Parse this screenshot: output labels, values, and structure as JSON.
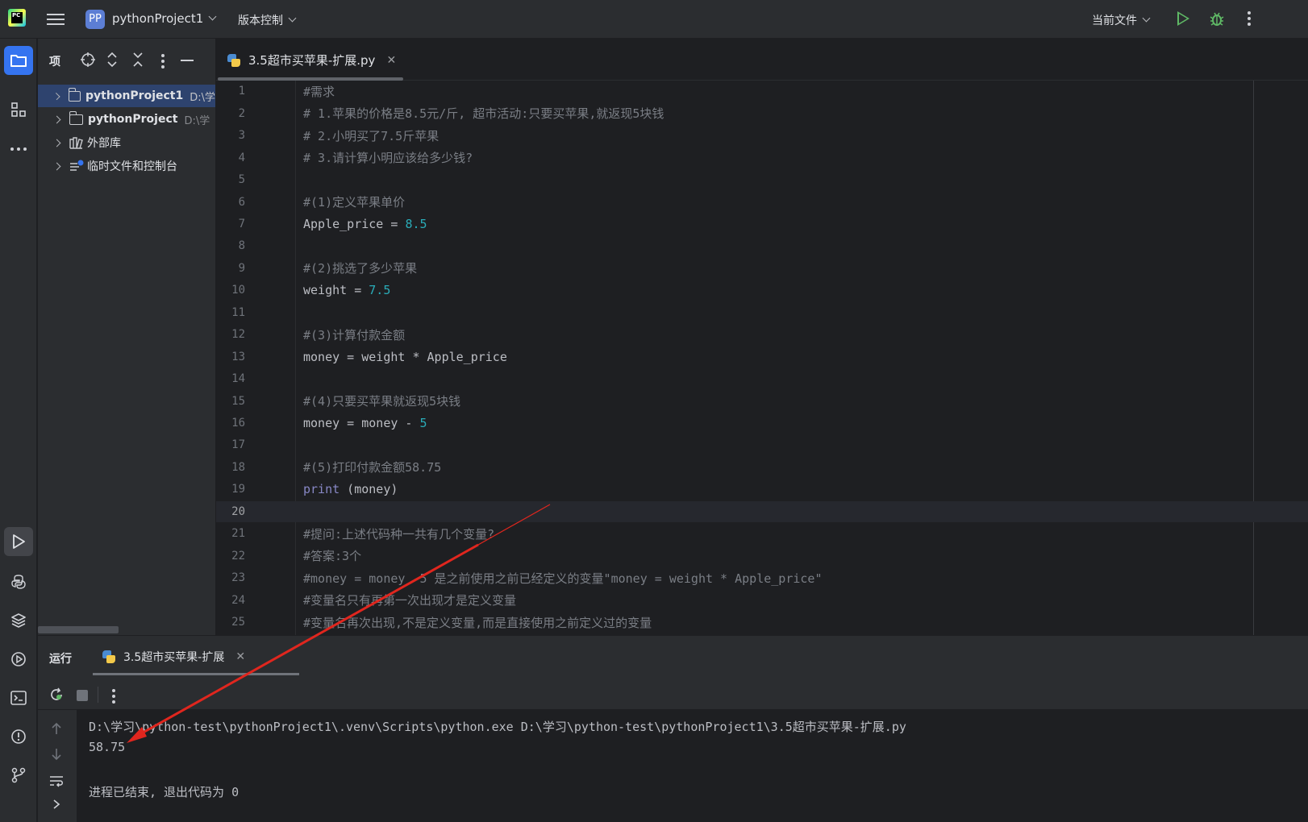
{
  "topbar": {
    "project_badge": "PP",
    "project_name": "pythonProject1",
    "vcs_label": "版本控制",
    "run_config": "当前文件"
  },
  "project_panel": {
    "title": "项",
    "tree": [
      {
        "name": "pythonProject1",
        "path": "D:\\学",
        "selected": true,
        "icon": "folder-icon"
      },
      {
        "name": "pythonProject",
        "path": "D:\\学",
        "selected": false,
        "icon": "folder-icon"
      },
      {
        "name": "外部库",
        "path": "",
        "selected": false,
        "icon": "library-icon"
      },
      {
        "name": "临时文件和控制台",
        "path": "",
        "selected": false,
        "icon": "scratch-icon"
      }
    ]
  },
  "editor": {
    "tab_label": "3.5超市买苹果-扩展.py",
    "current_line": 20,
    "lines": [
      {
        "n": "1",
        "segs": [
          {
            "t": "#需求",
            "c": "com"
          }
        ]
      },
      {
        "n": "2",
        "segs": [
          {
            "t": "# 1.苹果的价格是8.5元/斤, 超市活动:只要买苹果,就返现5块钱",
            "c": "com"
          }
        ]
      },
      {
        "n": "3",
        "segs": [
          {
            "t": "# 2.小明买了7.5斤苹果",
            "c": "com"
          }
        ]
      },
      {
        "n": "4",
        "segs": [
          {
            "t": "# 3.请计算小明应该给多少钱?",
            "c": "com"
          }
        ]
      },
      {
        "n": "5",
        "segs": []
      },
      {
        "n": "6",
        "segs": [
          {
            "t": "#(1)定义苹果单价",
            "c": "com"
          }
        ]
      },
      {
        "n": "7",
        "segs": [
          {
            "t": "Apple_price = ",
            "c": "id"
          },
          {
            "t": "8.5",
            "c": "num"
          }
        ]
      },
      {
        "n": "8",
        "segs": []
      },
      {
        "n": "9",
        "segs": [
          {
            "t": "#(2)挑选了多少苹果",
            "c": "com"
          }
        ]
      },
      {
        "n": "10",
        "segs": [
          {
            "t": "weight = ",
            "c": "id"
          },
          {
            "t": "7.5",
            "c": "num"
          }
        ]
      },
      {
        "n": "11",
        "segs": []
      },
      {
        "n": "12",
        "segs": [
          {
            "t": "#(3)计算付款金额",
            "c": "com"
          }
        ]
      },
      {
        "n": "13",
        "segs": [
          {
            "t": "money = weight * Apple_price",
            "c": "id"
          }
        ]
      },
      {
        "n": "14",
        "segs": []
      },
      {
        "n": "15",
        "segs": [
          {
            "t": "#(4)只要买苹果就返现5块钱",
            "c": "com"
          }
        ]
      },
      {
        "n": "16",
        "segs": [
          {
            "t": "money = money - ",
            "c": "id"
          },
          {
            "t": "5",
            "c": "num"
          }
        ]
      },
      {
        "n": "17",
        "segs": []
      },
      {
        "n": "18",
        "segs": [
          {
            "t": "#(5)打印付款金额58.75",
            "c": "com"
          }
        ]
      },
      {
        "n": "19",
        "segs": [
          {
            "t": "print",
            "c": "fn"
          },
          {
            "t": " (money)",
            "c": "id"
          }
        ]
      },
      {
        "n": "20",
        "segs": []
      },
      {
        "n": "21",
        "segs": [
          {
            "t": "#提问:上述代码种一共有几个变量?",
            "c": "com"
          }
        ]
      },
      {
        "n": "22",
        "segs": [
          {
            "t": "#答案:3个",
            "c": "com"
          }
        ]
      },
      {
        "n": "23",
        "segs": [
          {
            "t": "#money = money -5 是之前使用之前已经定义的变量\"money = weight * Apple_price\"",
            "c": "com"
          }
        ]
      },
      {
        "n": "24",
        "segs": [
          {
            "t": "#变量名只有再第一次出现才是定义变量",
            "c": "com"
          }
        ]
      },
      {
        "n": "25",
        "segs": [
          {
            "t": "#变量名再次出现,不是定义变量,而是直接使用之前定义过的变量",
            "c": "com"
          }
        ]
      }
    ]
  },
  "run_panel": {
    "title": "运行",
    "tab_label": "3.5超市买苹果-扩展",
    "output": [
      "D:\\学习\\python-test\\pythonProject1\\.venv\\Scripts\\python.exe D:\\学习\\python-test\\pythonProject1\\3.5超市买苹果-扩展.py",
      "58.75",
      "",
      "进程已结束, 退出代码为 0"
    ]
  },
  "colors": {
    "accent": "#3574f0",
    "annotation_arrow": "#e0261e",
    "comment": "#7a7e85",
    "number": "#2aacb8",
    "builtin": "#8888c6"
  }
}
